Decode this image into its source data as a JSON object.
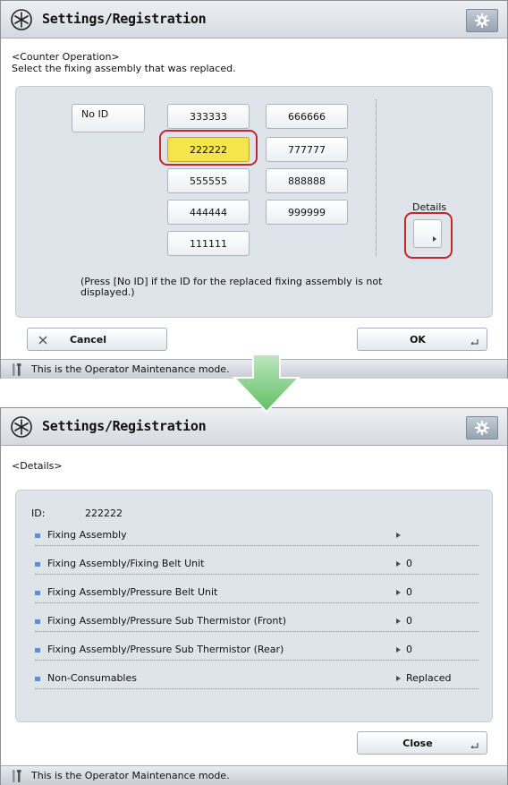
{
  "screen1": {
    "title": "Settings/Registration",
    "heading_line1": "<Counter Operation>",
    "heading_line2": "Select the fixing assembly that was replaced.",
    "no_id_label": "No ID",
    "ids_col1": [
      "333333",
      "222222",
      "555555",
      "444444",
      "111111"
    ],
    "ids_col2": [
      "666666",
      "777777",
      "888888",
      "999999"
    ],
    "selected_id": "222222",
    "details_label": "Details",
    "note_line1": "(Press [No ID] if the ID for the replaced fixing assembly is not",
    "note_line2": "displayed.)",
    "cancel_label": "Cancel",
    "ok_label": "OK",
    "status": "This is the Operator Maintenance mode."
  },
  "screen2": {
    "title": "Settings/Registration",
    "heading": "<Details>",
    "id_label": "ID:",
    "id_value": "222222",
    "rows": [
      {
        "label": "Fixing Assembly",
        "value": ""
      },
      {
        "label": "Fixing Assembly/Fixing Belt Unit",
        "value": "0"
      },
      {
        "label": "Fixing Assembly/Pressure Belt Unit",
        "value": "0"
      },
      {
        "label": "Fixing Assembly/Pressure Sub Thermistor (Front)",
        "value": "0"
      },
      {
        "label": "Fixing Assembly/Pressure Sub Thermistor (Rear)",
        "value": "0"
      },
      {
        "label": "Non-Consumables",
        "value": "Replaced"
      }
    ],
    "close_label": "Close",
    "status": "This is the Operator Maintenance mode."
  },
  "colors": {
    "selected": "#f6e44c",
    "highlight": "#c0282e",
    "arrow": "#6cc36f",
    "bullet": "#5d8fd0"
  }
}
